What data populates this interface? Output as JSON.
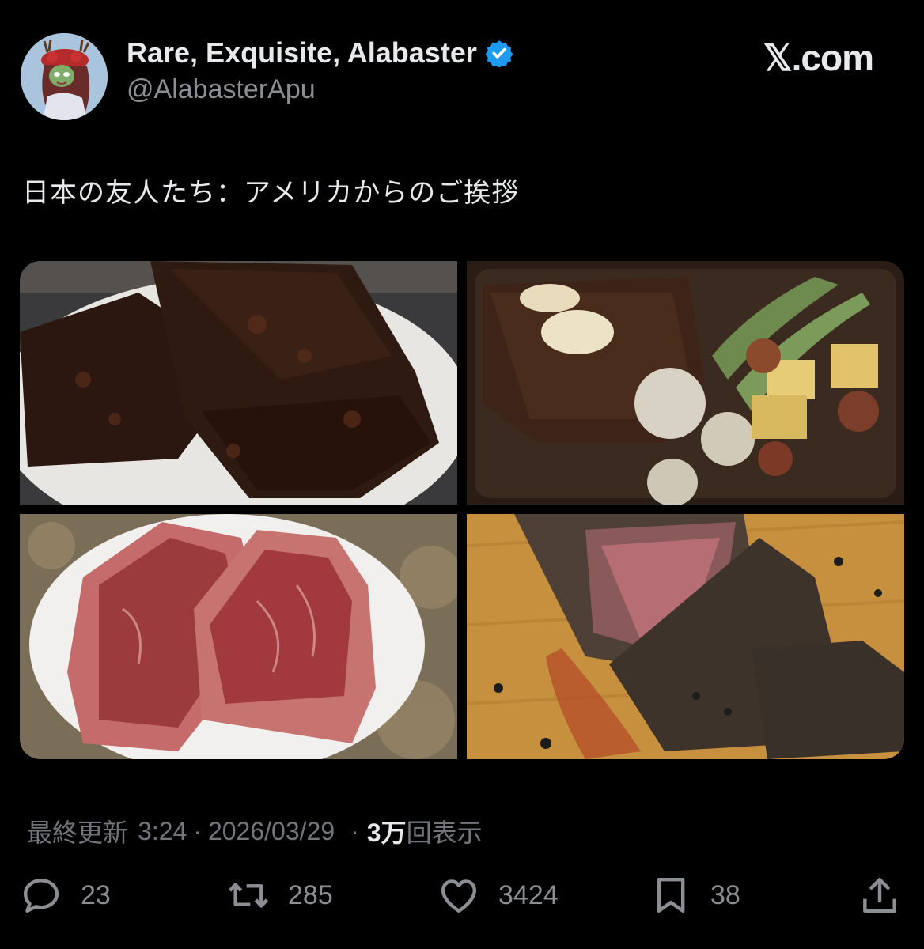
{
  "author": {
    "display_name": "Rare, Exquisite, Alabaster",
    "handle": "@AlabasterApu",
    "verified": true,
    "avatar_icon": "avatar-illustration"
  },
  "site_label": "𝕏.com",
  "post": {
    "text": "日本の友人たち：アメリカからのご挨拶",
    "media": [
      {
        "name": "bbq-ribs-photo"
      },
      {
        "name": "grilled-steak-board-photo"
      },
      {
        "name": "raw-steaks-plate-photo"
      },
      {
        "name": "sliced-roast-beef-photo"
      }
    ]
  },
  "meta": {
    "updated_label": "最終更新",
    "time": "3:24",
    "dot1": "·",
    "date": "2026/03/29",
    "dot2": "·",
    "views_count": "3万",
    "views_label": "回表示"
  },
  "actions": {
    "replies": "23",
    "reposts": "285",
    "likes": "3424",
    "bookmarks": "38"
  },
  "colors": {
    "background": "#000000",
    "text": "#e7e9ea",
    "muted": "#71767b",
    "verified": "#1d9bf0"
  }
}
